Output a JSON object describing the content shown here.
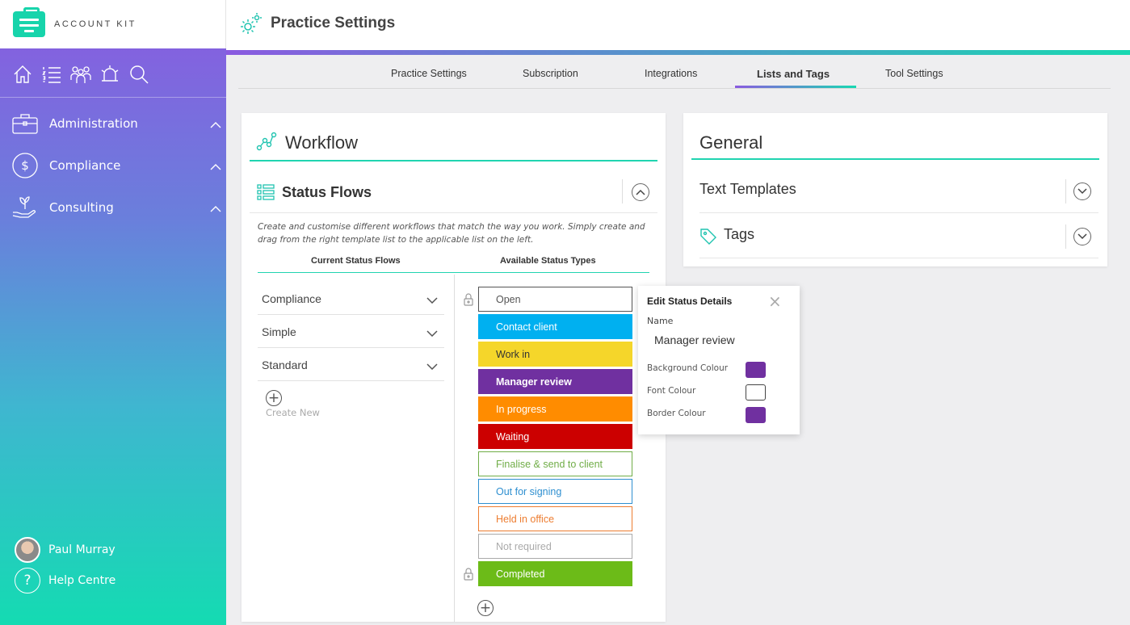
{
  "app": {
    "brand": "ACCOUNT KIT",
    "page_title": "Practice Settings"
  },
  "sidebar": {
    "top_icons": [
      "home-icon",
      "list-icon",
      "people-icon",
      "alarm-icon",
      "search-icon"
    ],
    "items": [
      {
        "label": "Administration",
        "icon": "briefcase-icon"
      },
      {
        "label": "Compliance",
        "icon": "dollar-icon"
      },
      {
        "label": "Consulting",
        "icon": "plant-hand-icon"
      }
    ],
    "user_name": "Paul Murray",
    "help_label": "Help Centre"
  },
  "tabs": [
    {
      "label": "Practice Settings",
      "active": false
    },
    {
      "label": "Subscription",
      "active": false
    },
    {
      "label": "Integrations",
      "active": false
    },
    {
      "label": "Lists and Tags",
      "active": true
    },
    {
      "label": "Tool Settings",
      "active": false
    }
  ],
  "workflow": {
    "title": "Workflow",
    "section_title": "Status Flows",
    "description": "Create and customise different workflows that match the way you work. Simply create and drag from the right template list to the applicable list on the left.",
    "col_current": "Current Status Flows",
    "col_available": "Available Status Types",
    "flows": [
      "Compliance",
      "Simple",
      "Standard"
    ],
    "create_label": "Create New",
    "statuses": [
      {
        "label": "Open",
        "bg": "#ffffff",
        "fg": "#555555",
        "border": "#555555",
        "bold": false,
        "locked": true
      },
      {
        "label": "Contact client",
        "bg": "#00b0f0",
        "fg": "#ffffff",
        "border": "#00b0f0",
        "bold": false,
        "locked": false
      },
      {
        "label": "Work in",
        "bg": "#f5d62a",
        "fg": "#333333",
        "border": "#f5d62a",
        "bold": false,
        "locked": false
      },
      {
        "label": "Manager review",
        "bg": "#7030a0",
        "fg": "#ffffff",
        "border": "#7030a0",
        "bold": true,
        "locked": false
      },
      {
        "label": "In progress",
        "bg": "#ff8c00",
        "fg": "#ffffff",
        "border": "#ff8c00",
        "bold": false,
        "locked": false
      },
      {
        "label": "Waiting",
        "bg": "#cc0000",
        "fg": "#ffffff",
        "border": "#cc0000",
        "bold": false,
        "locked": false
      },
      {
        "label": "Finalise & send to client",
        "bg": "#ffffff",
        "fg": "#70ad47",
        "border": "#70ad47",
        "bold": false,
        "locked": false
      },
      {
        "label": "Out for signing",
        "bg": "#ffffff",
        "fg": "#2e8fd0",
        "border": "#2e8fd0",
        "bold": false,
        "locked": false
      },
      {
        "label": "Held in office",
        "bg": "#ffffff",
        "fg": "#ed7d31",
        "border": "#ed7d31",
        "bold": false,
        "locked": false
      },
      {
        "label": "Not required",
        "bg": "#ffffff",
        "fg": "#aaaaaa",
        "border": "#aaaaaa",
        "bold": false,
        "locked": false
      },
      {
        "label": "Completed",
        "bg": "#6cbb18",
        "fg": "#ffffff",
        "border": "#6cbb18",
        "bold": false,
        "locked": true
      }
    ]
  },
  "general": {
    "title": "General",
    "rows": [
      {
        "label": "Text Templates"
      },
      {
        "label": "Tags",
        "icon": "tag-icon"
      }
    ]
  },
  "popup": {
    "title": "Edit Status Details",
    "name_label": "Name",
    "name_value": "Manager review",
    "bg_label": "Background Colour",
    "bg_color": "#7030a0",
    "font_label": "Font Colour",
    "font_color": "#ffffff",
    "border_label": "Border Colour",
    "border_color": "#7030a0"
  },
  "colors": {
    "accent_teal": "#20d4b0",
    "accent_purple": "#8a5ae0"
  }
}
